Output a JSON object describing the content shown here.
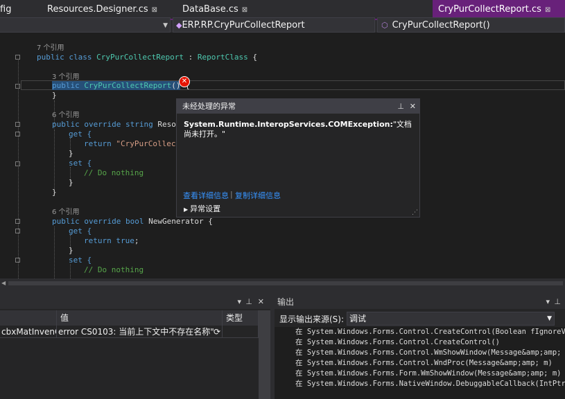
{
  "tabs": [
    {
      "label": "fig",
      "close": "⊠"
    },
    {
      "label": "Resources.Designer.cs",
      "close": "⊠"
    },
    {
      "label": "DataBase.cs",
      "close": "⊠"
    },
    {
      "label": "CryPurCollectReport.cs",
      "close": "⊠",
      "active": true
    }
  ],
  "nav": {
    "project": "",
    "class": "ERP.RP.CryPurCollectReport",
    "member": "CryPurCollectReport()"
  },
  "code": {
    "ref7": "7 个引用",
    "class_decl": {
      "kw1": "public",
      "kw2": "class",
      "name": "CryPurCollectReport",
      "sep": " : ",
      "base": "ReportClass",
      "brace": " {"
    },
    "ref3": "3 个引用",
    "ctor": {
      "kw": "public",
      "name": "CryPurCollectReport",
      "parens": "()",
      "brace": " {"
    },
    "close1": "}",
    "ref6a": "6 个引用",
    "prop1": {
      "kw1": "public",
      "kw2": "override",
      "kw3": "string",
      "name": "ResourceN"
    },
    "get1": "get {",
    "return1": {
      "kw": "return",
      "str": "\"CryPurCollectRep"
    },
    "close2": "}",
    "set1": "set {",
    "comment1": "// Do nothing",
    "close3": "}",
    "close4": "}",
    "ref6b": "6 个引用",
    "prop2": {
      "kw1": "public",
      "kw2": "override",
      "kw3": "bool",
      "name": "NewGenerator",
      "brace": " {"
    },
    "get2": "get {",
    "return2": {
      "kw": "return",
      "val": "true",
      "end": ";"
    },
    "close5": "}",
    "set2": "set {",
    "comment2": "// Do nothing"
  },
  "exception": {
    "title": "未经处理的异常",
    "pin": "⊥",
    "close": "✕",
    "type": "System.Runtime.InteropServices.COMException:",
    "message": "\"文档尚未打开。\"",
    "link_details": "查看详细信息",
    "link_copy": "复制详细信息",
    "settings": "异常设置",
    "error_glyph": "✕"
  },
  "left_panel": {
    "col_name": "",
    "col_value": "值",
    "col_type": "类型",
    "row_name": "cbxMatInvenCo",
    "row_value": "error CS0103: 当前上下文中不存在名称\"",
    "pin": "⊥",
    "close": "✕"
  },
  "output": {
    "title": "输出",
    "source_label": "显示输出来源(S):",
    "source_value": "调试",
    "pin": "⊥",
    "close": "✕",
    "lines": [
      "在 System.Windows.Forms.Control.CreateControl(Boolean fIgnoreVisi",
      "在 System.Windows.Forms.Control.CreateControl()",
      "在 System.Windows.Forms.Control.WmShowWindow(Message&amp;amp; m)",
      "在 System.Windows.Forms.Control.WndProc(Message&amp;amp; m)",
      "在 System.Windows.Forms.Form.WmShowWindow(Message&amp;amp; m)",
      "在 System.Windows.Forms.NativeWindow.DebuggableCallback(IntPtr hW"
    ]
  }
}
